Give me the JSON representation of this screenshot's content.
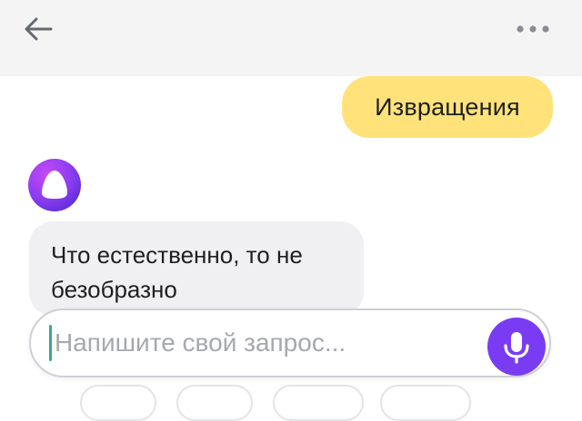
{
  "header": {
    "back_icon": "arrow-left-icon",
    "more_icon": "more-horizontal-icon"
  },
  "chat": {
    "messages": [
      {
        "from": "user",
        "text": "Извращения"
      },
      {
        "from": "assistant",
        "text": "Что естественно, то не безобразно"
      }
    ],
    "assistant_avatar_icon": "alice-logo-icon"
  },
  "composer": {
    "placeholder": "Напишите свой запрос...",
    "value": "",
    "mic_icon": "microphone-icon"
  },
  "colors": {
    "user_bubble": "#ffe37a",
    "assistant_bubble": "#f0f0f2",
    "accent": "#7a3cf2",
    "header_bg": "#f4f4f5"
  }
}
